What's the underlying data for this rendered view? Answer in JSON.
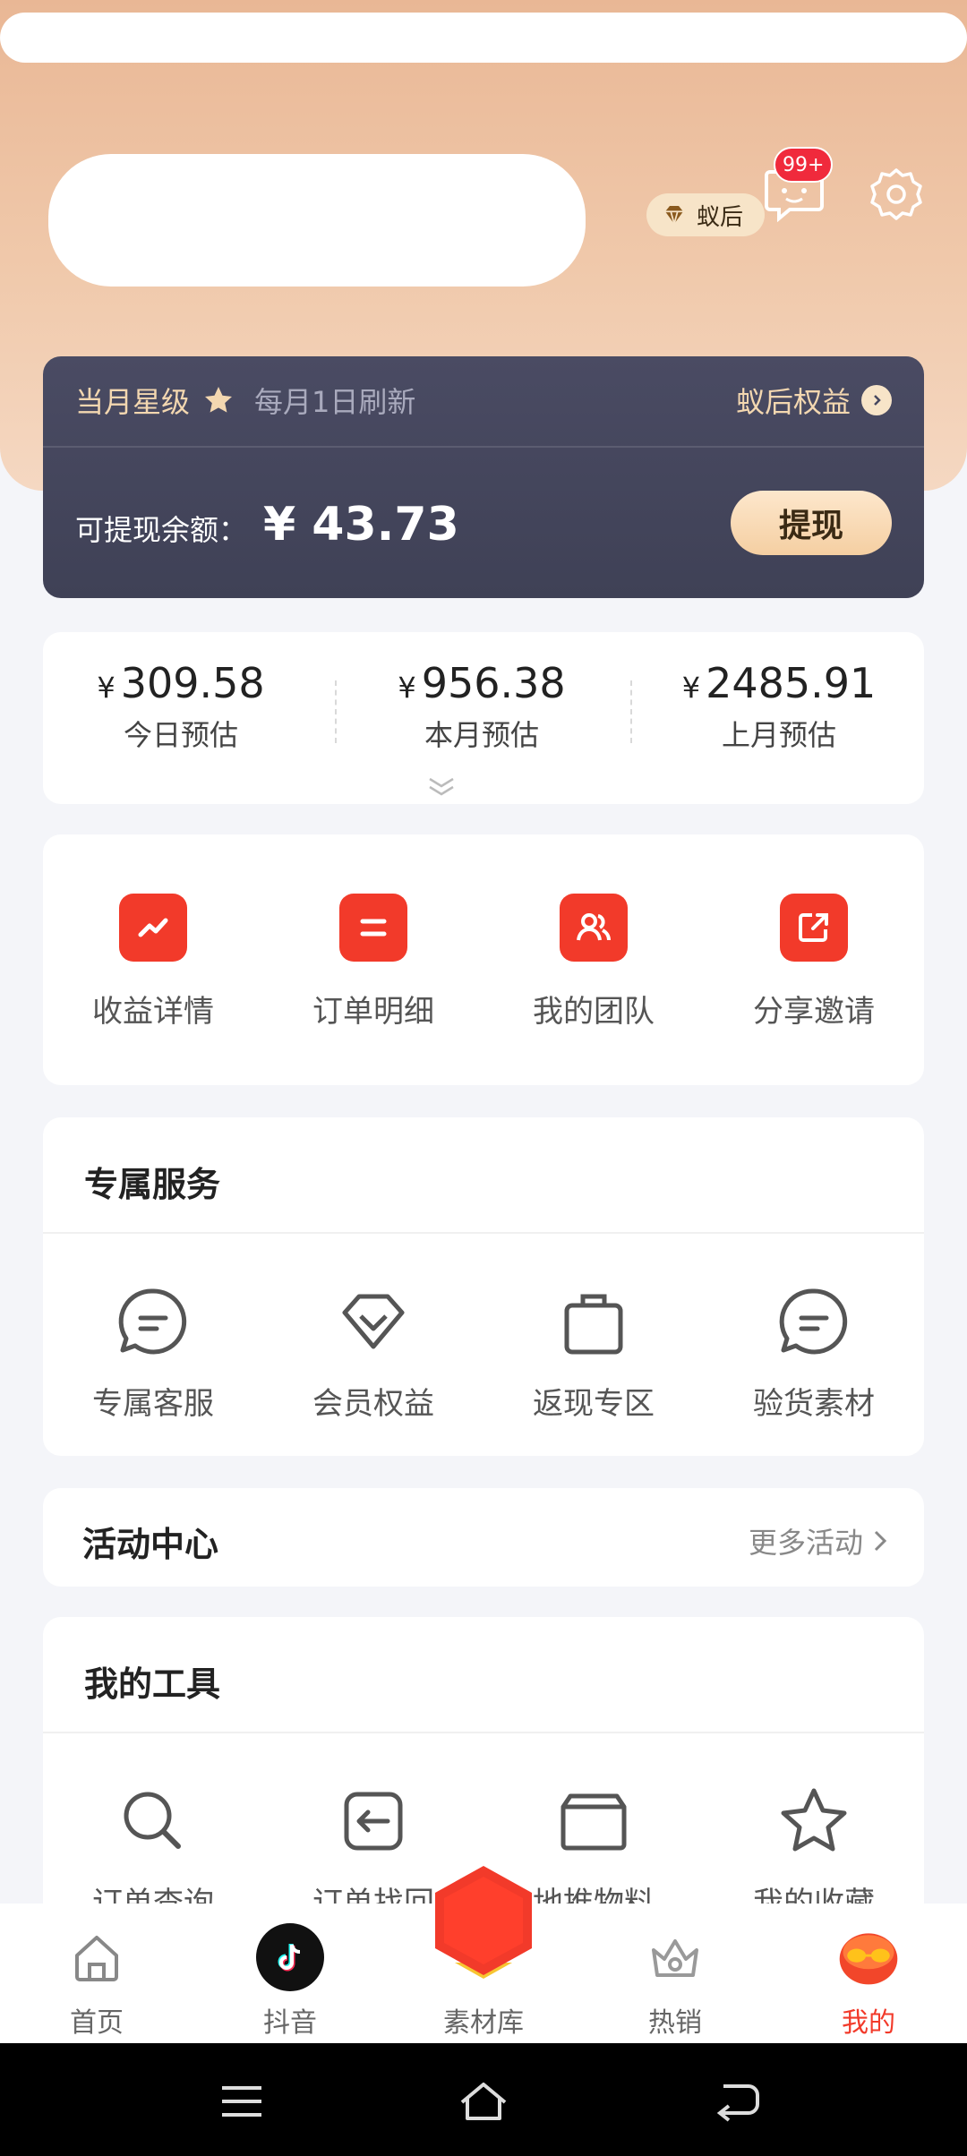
{
  "header": {
    "level_badge": "蚁后",
    "message_badge": "99+"
  },
  "member_card": {
    "star_level_label": "当月星级",
    "refresh_note": "每月1日刷新",
    "benefits_link": "蚁后权益",
    "balance_label": "可提现余额：",
    "balance_amount": "¥ 43.73",
    "withdraw_button": "提现"
  },
  "earnings": [
    {
      "currency": "¥",
      "value": "309.58",
      "label": "今日预估"
    },
    {
      "currency": "¥",
      "value": "956.38",
      "label": "本月预估"
    },
    {
      "currency": "¥",
      "value": "2485.91",
      "label": "上月预估"
    }
  ],
  "quick_actions": [
    {
      "label": "收益详情",
      "icon": "trend-chart-icon"
    },
    {
      "label": "订单明细",
      "icon": "order-list-icon"
    },
    {
      "label": "我的团队",
      "icon": "team-icon"
    },
    {
      "label": "分享邀请",
      "icon": "share-icon"
    }
  ],
  "exclusive_services": {
    "title": "专属服务",
    "items": [
      {
        "label": "专属客服",
        "icon": "chat-bubble-icon"
      },
      {
        "label": "会员权益",
        "icon": "diamond-icon"
      },
      {
        "label": "返现专区",
        "icon": "shopping-bag-icon"
      },
      {
        "label": "验货素材",
        "icon": "chat-bubble-icon"
      }
    ]
  },
  "activity_center": {
    "title": "活动中心",
    "more_link": "更多活动"
  },
  "my_tools": {
    "title": "我的工具",
    "items": [
      {
        "label": "订单查询",
        "icon": "search-icon"
      },
      {
        "label": "订单找回",
        "icon": "retrieve-icon"
      },
      {
        "label": "地推物料",
        "icon": "box-icon"
      },
      {
        "label": "我的收藏",
        "icon": "star-icon"
      }
    ]
  },
  "tabbar": [
    {
      "label": "首页",
      "icon": "home-icon"
    },
    {
      "label": "抖音",
      "icon": "tiktok-icon"
    },
    {
      "label": "素材库",
      "icon": "hexagon-icon"
    },
    {
      "label": "热销",
      "icon": "crown-icon"
    },
    {
      "label": "我的",
      "icon": "avatar-icon",
      "active": true
    }
  ],
  "colors": {
    "accent_red": "#f23a2a",
    "card_dark": "#454760",
    "gold_text": "#f3d7b0"
  }
}
